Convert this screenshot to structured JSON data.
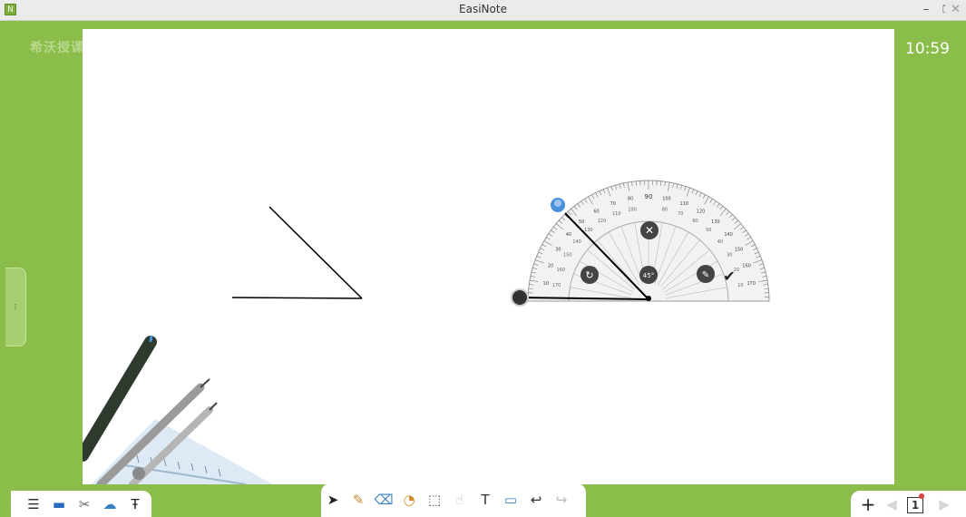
{
  "window": {
    "title": "EasiNote",
    "minimize": "–",
    "maximize": "❐",
    "close": "✕",
    "app_icon": "N"
  },
  "brand": {
    "text": "希沃授课"
  },
  "clock": {
    "time": "10:59"
  },
  "side_panel": {
    "handle_icon": "⁝"
  },
  "protractor": {
    "top_label": "90",
    "angle_badge": "45°",
    "outer_scale": [
      "10",
      "20",
      "30",
      "40",
      "50",
      "60",
      "70",
      "80",
      "90",
      "100",
      "110",
      "120",
      "130",
      "140",
      "150",
      "160",
      "170"
    ],
    "inner_scale": [
      "170",
      "160",
      "150",
      "140",
      "130",
      "120",
      "110",
      "100",
      "80",
      "70",
      "60",
      "50",
      "40",
      "30",
      "20",
      "10"
    ],
    "controls": [
      "close-icon",
      "rotate-icon",
      "edit-icon",
      "confirm-icon"
    ]
  },
  "toolbar_left": {
    "items": [
      {
        "name": "menu-icon",
        "glyph": "☰"
      },
      {
        "name": "screen-icon",
        "glyph": "▬"
      },
      {
        "name": "tools-icon",
        "glyph": "✂"
      },
      {
        "name": "cloud-icon",
        "glyph": "☁"
      },
      {
        "name": "text-tool-icon",
        "glyph": "Ŧ"
      }
    ]
  },
  "toolbar_center": {
    "items": [
      {
        "name": "select-icon",
        "glyph": "➤"
      },
      {
        "name": "pen-icon",
        "glyph": "✎"
      },
      {
        "name": "eraser-icon",
        "glyph": "⌫"
      },
      {
        "name": "shape-icon",
        "glyph": "◔"
      },
      {
        "name": "cube-icon",
        "glyph": "⬚"
      },
      {
        "name": "hand-icon",
        "glyph": "☝"
      },
      {
        "name": "text-icon",
        "glyph": "T"
      },
      {
        "name": "note-icon",
        "glyph": "▭"
      },
      {
        "name": "undo-icon",
        "glyph": "↩"
      },
      {
        "name": "redo-icon",
        "glyph": "↪"
      }
    ]
  },
  "toolbar_right": {
    "add": "+",
    "prev": "◀",
    "page_number": "1",
    "next": "▶"
  },
  "colors": {
    "accent_green": "#8bbd4a",
    "canvas": "#ffffff",
    "handle_blue": "#4a90d9"
  }
}
